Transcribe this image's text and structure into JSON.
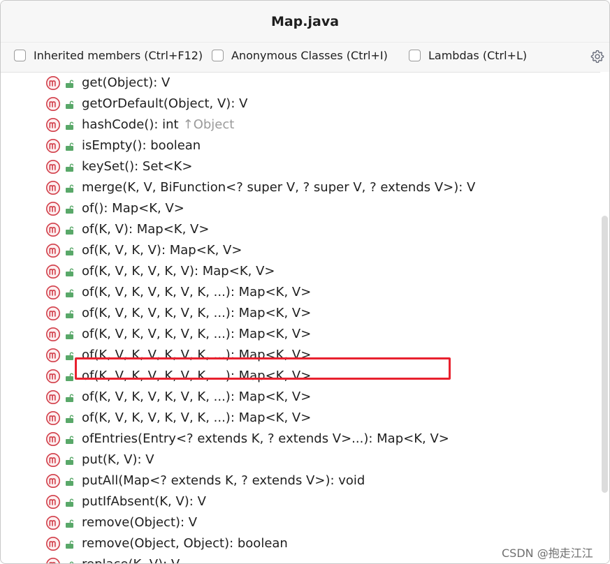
{
  "window": {
    "title": "Map.java"
  },
  "toolbar": {
    "options": [
      {
        "label": "Inherited members (Ctrl+F12)",
        "checked": false
      },
      {
        "label": "Anonymous Classes (Ctrl+I)",
        "checked": false
      },
      {
        "label": "Lambdas (Ctrl+L)",
        "checked": false
      }
    ],
    "settings_icon": "gear-icon"
  },
  "members": [
    {
      "signature": "get(Object): V"
    },
    {
      "signature": "getOrDefault(Object, V): V"
    },
    {
      "signature": "hashCode(): int",
      "inherited_from": "↑Object"
    },
    {
      "signature": "isEmpty(): boolean"
    },
    {
      "signature": "keySet(): Set<K>"
    },
    {
      "signature": "merge(K, V, BiFunction<? super V, ? super V, ? extends V>): V"
    },
    {
      "signature": "of(): Map<K, V>"
    },
    {
      "signature": "of(K, V): Map<K, V>"
    },
    {
      "signature": "of(K, V, K, V): Map<K, V>"
    },
    {
      "signature": "of(K, V, K, V, K, V): Map<K, V>"
    },
    {
      "signature": "of(K, V, K, V, K, V, K, ...): Map<K, V>"
    },
    {
      "signature": "of(K, V, K, V, K, V, K, ...): Map<K, V>"
    },
    {
      "signature": "of(K, V, K, V, K, V, K, ...): Map<K, V>"
    },
    {
      "signature": "of(K, V, K, V, K, V, K, ...): Map<K, V>"
    },
    {
      "signature": "of(K, V, K, V, K, V, K, ...): Map<K, V>"
    },
    {
      "signature": "of(K, V, K, V, K, V, K, ...): Map<K, V>"
    },
    {
      "signature": "of(K, V, K, V, K, V, K, ...): Map<K, V>"
    },
    {
      "signature": "ofEntries(Entry<? extends K, ? extends V>...): Map<K, V>",
      "highlighted": true
    },
    {
      "signature": "put(K, V): V"
    },
    {
      "signature": "putAll(Map<? extends K, ? extends V>): void"
    },
    {
      "signature": "putIfAbsent(K, V): V"
    },
    {
      "signature": "remove(Object): V"
    },
    {
      "signature": "remove(Object, Object): boolean"
    },
    {
      "signature": "replace(K, V): V"
    }
  ],
  "icons": {
    "method": "method-m-icon",
    "visibility": "public-lock-icon"
  },
  "colors": {
    "method_icon": "#d23f4a",
    "lock": "#59a869",
    "highlight": "#e8212e",
    "inherited_text": "#9a9a9a"
  },
  "watermark": "CSDN @抱走江江"
}
